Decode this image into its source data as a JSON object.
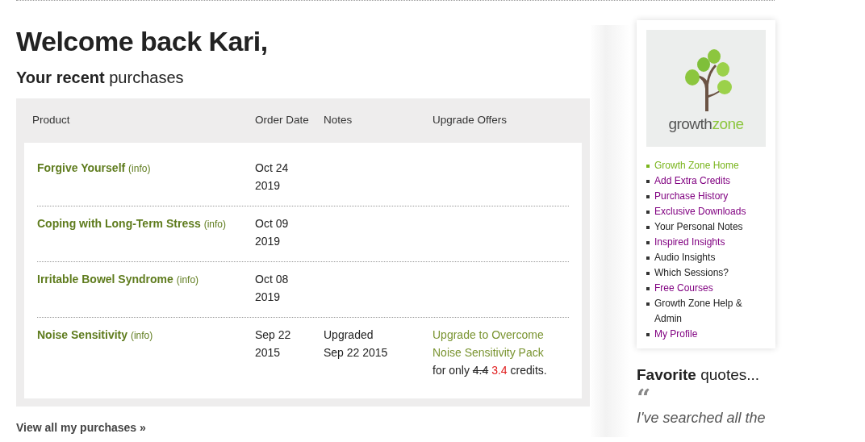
{
  "heading": "Welcome back Kari,",
  "subheading": "**Your recent** purchases",
  "table": {
    "columns": [
      "Product",
      "Order Date",
      "Notes",
      "Upgrade Offers"
    ],
    "rows": [
      {
        "product": "Forgive Yourself",
        "info": "(info)",
        "date_line_1": "Oct 24",
        "date_line_2": "2019"
      },
      {
        "product": "Coping with Long-Term Stress",
        "info": "(info)",
        "date_line_1": "Oct 09",
        "date_line_2": "2019"
      },
      {
        "product": "Irritable Bowel Syndrome",
        "info": "(info)",
        "date_line_1": "Oct 08",
        "date_line_2": "2019"
      },
      {
        "product": "Noise Sensitivity",
        "info": "(info)",
        "date_line_1": "Sep 22",
        "date_line_2": "2015",
        "note_line_1": "Upgraded",
        "note_line_2": "Sep 22 2015",
        "offer": {
          "link": "Upgrade to Overcome Noise Sensitivity Pack",
          "text_before": "for only",
          "old_price": "4.4",
          "new_price": "3.4",
          "text_after": "credits."
        }
      }
    ]
  },
  "view_all": "View all my purchases »",
  "sidebar": {
    "logo": {
      "word_1": "growth",
      "word_2": "zone"
    },
    "items": [
      {
        "label": "Growth Zone Home",
        "selected": true,
        "visited": false
      },
      {
        "label": "Add Extra Credits",
        "selected": false,
        "visited": true
      },
      {
        "label": "Purchase History",
        "selected": false,
        "visited": true
      },
      {
        "label": "Exclusive Downloads",
        "selected": false,
        "visited": true
      },
      {
        "label": "Your Personal Notes",
        "selected": false,
        "visited": false
      },
      {
        "label": "Inspired Insights",
        "selected": false,
        "visited": true
      },
      {
        "label": "Audio Insights",
        "selected": false,
        "visited": false
      },
      {
        "label": "Which Sessions?",
        "selected": false,
        "visited": false
      },
      {
        "label": "Free Courses",
        "selected": false,
        "visited": true
      },
      {
        "label": "Growth Zone Help & Admin",
        "selected": false,
        "visited": false
      },
      {
        "label": "My Profile",
        "selected": false,
        "visited": true
      }
    ]
  },
  "quotes": {
    "title": "**Favorite** quotes...",
    "mark": "“",
    "text": "I've searched all the"
  }
}
